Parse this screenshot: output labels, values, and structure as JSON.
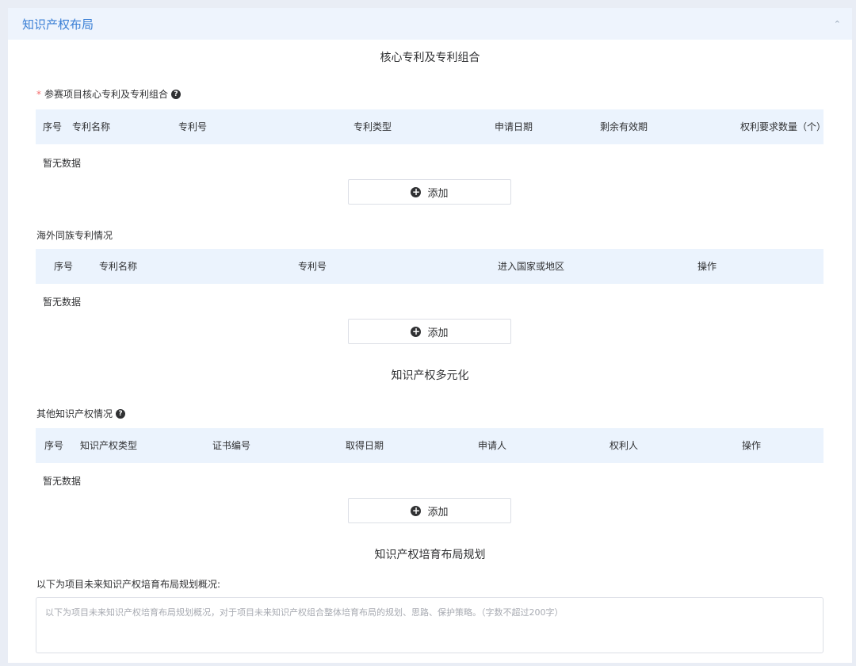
{
  "panel": {
    "title": "知识产权布局",
    "collapse_icon": "chevron-up-icon"
  },
  "core_patent": {
    "section_title": "核心专利及专利组合",
    "field_required_mark": "*",
    "field_label": "参赛项目核心专利及专利组合",
    "columns": [
      "序号",
      "专利名称",
      "专利号",
      "专利类型",
      "申请日期",
      "剩余有效期",
      "权利要求数量（个）"
    ],
    "empty_text": "暂无数据",
    "add_label": "添加"
  },
  "overseas_patent": {
    "field_label": "海外同族专利情况",
    "columns": [
      "序号",
      "专利名称",
      "专利号",
      "进入国家或地区",
      "操作"
    ],
    "empty_text": "暂无数据",
    "add_label": "添加"
  },
  "diversification": {
    "section_title": "知识产权多元化",
    "field_label": "其他知识产权情况",
    "columns": [
      "序号",
      "知识产权类型",
      "证书编号",
      "取得日期",
      "申请人",
      "权利人",
      "操作"
    ],
    "empty_text": "暂无数据",
    "add_label": "添加"
  },
  "planning": {
    "section_title": "知识产权培育布局规划",
    "field_label": "以下为项目未来知识产权培育布局规划概况:",
    "textarea_value": "",
    "textarea_placeholder": "以下为项目未来知识产权培育布局规划概况，对于项目未来知识产权组合整体培育布局的规划、思路、保护策略。（字数不超过200字）"
  },
  "colors": {
    "accent": "#3a7fd5",
    "header_bg": "#eef4fd",
    "table_head_bg": "#ebf3fd",
    "required": "#f56c6c"
  }
}
